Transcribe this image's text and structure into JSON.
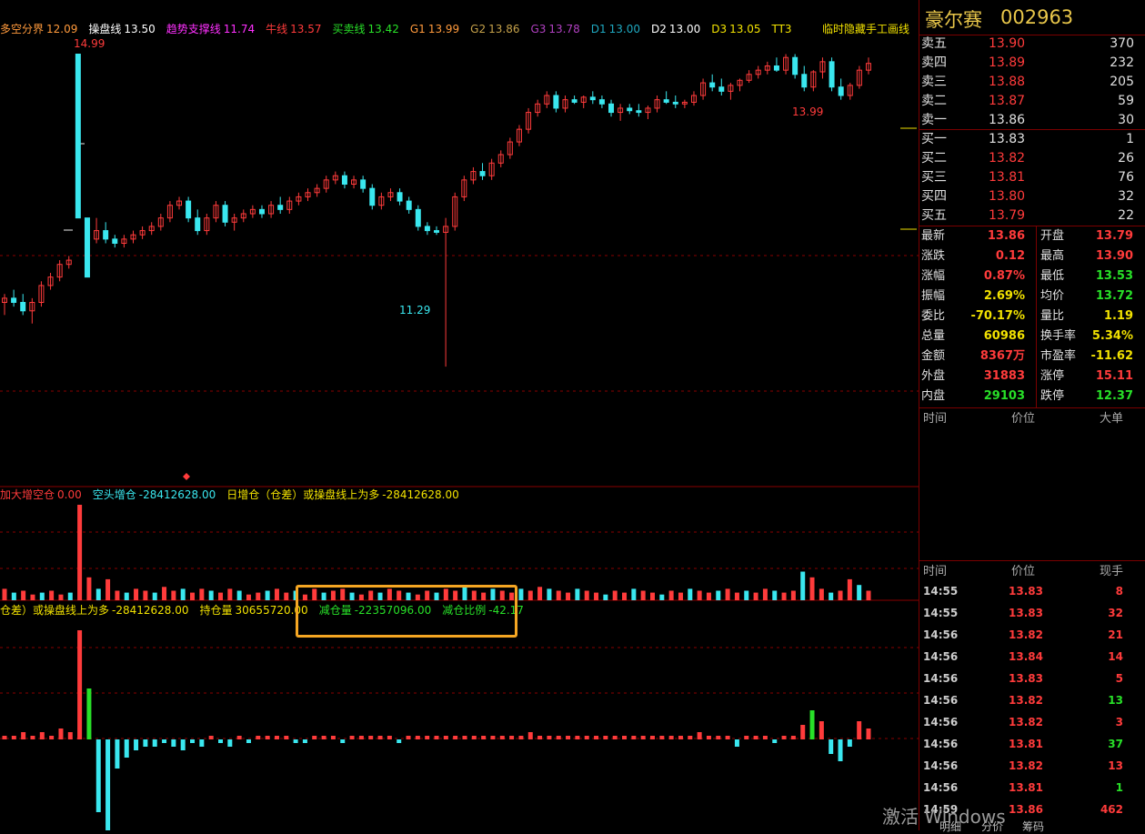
{
  "indicator_top": {
    "items": [
      {
        "label": "多空分界",
        "value": "12.09",
        "color": "#ff9a3c"
      },
      {
        "label": "操盘线",
        "value": "13.50",
        "color": "#ffffff"
      },
      {
        "label": "趋势支撑线",
        "value": "11.74",
        "color": "#ff30ff"
      },
      {
        "label": "牛线",
        "value": "13.57",
        "color": "#ff3b3b"
      },
      {
        "label": "买卖线",
        "value": "13.42",
        "color": "#28e028"
      },
      {
        "label": "G1",
        "value": "13.99",
        "color": "#ff9a3c"
      },
      {
        "label": "G2",
        "value": "13.86",
        "color": "#c5a14a"
      },
      {
        "label": "G3",
        "value": "13.78",
        "color": "#b040c0"
      },
      {
        "label": "D1",
        "value": "13.00",
        "color": "#1fa8c0"
      },
      {
        "label": "D2",
        "value": "13.00",
        "color": "#ffffff"
      },
      {
        "label": "D3",
        "value": "13.05",
        "color": "#f2e200"
      },
      {
        "label": "TT3",
        "value": "",
        "color": "#f2e200"
      }
    ],
    "right_label": "临时隐藏手工画线"
  },
  "indicator_mid": {
    "items": [
      {
        "label": "加大增空仓",
        "value": "0.00",
        "color": "#ff3b3b"
      },
      {
        "label": "空头增仓",
        "value": "-28412628.00",
        "color": "#3ae7ef"
      },
      {
        "label": "日增仓（仓差）或操盘线上为多",
        "value": "-28412628.00",
        "color": "#f2e200"
      }
    ]
  },
  "indicator_low": {
    "items": [
      {
        "label": "仓差）或操盘线上为多",
        "value": "-28412628.00",
        "color": "#f2e200"
      },
      {
        "label": "持仓量",
        "value": "30655720.00",
        "color": "#f2e200"
      },
      {
        "label": "减仓量",
        "value": "-22357096.00",
        "color": "#28e028"
      },
      {
        "label": "减仓比例",
        "value": "-42.17",
        "color": "#28e028"
      }
    ]
  },
  "price_labels": {
    "high": "14.99",
    "low": "11.29",
    "recent_high": "13.99"
  },
  "stock": {
    "name": "豪尔赛",
    "code": "002963"
  },
  "order_book": {
    "asks": [
      {
        "label": "卖五",
        "price": "13.90",
        "vol": "370",
        "color": "#ff3b3b"
      },
      {
        "label": "卖四",
        "price": "13.89",
        "vol": "232",
        "color": "#ff3b3b"
      },
      {
        "label": "卖三",
        "price": "13.88",
        "vol": "205",
        "color": "#ff3b3b"
      },
      {
        "label": "卖二",
        "price": "13.87",
        "vol": "59",
        "color": "#ff3b3b"
      },
      {
        "label": "卖一",
        "price": "13.86",
        "vol": "30",
        "color": "#e0e0e0"
      }
    ],
    "bids": [
      {
        "label": "买一",
        "price": "13.83",
        "vol": "1",
        "color": "#e0e0e0"
      },
      {
        "label": "买二",
        "price": "13.82",
        "vol": "26",
        "color": "#ff3b3b"
      },
      {
        "label": "买三",
        "price": "13.81",
        "vol": "76",
        "color": "#ff3b3b"
      },
      {
        "label": "买四",
        "price": "13.80",
        "vol": "32",
        "color": "#ff3b3b"
      },
      {
        "label": "买五",
        "price": "13.79",
        "vol": "22",
        "color": "#ff3b3b"
      }
    ]
  },
  "quote": [
    {
      "l1": "最新",
      "v1": "13.86",
      "c1": "#ff3b3b",
      "l2": "开盘",
      "v2": "13.79",
      "c2": "#ff3b3b"
    },
    {
      "l1": "涨跌",
      "v1": "0.12",
      "c1": "#ff3b3b",
      "l2": "最高",
      "v2": "13.90",
      "c2": "#ff3b3b"
    },
    {
      "l1": "涨幅",
      "v1": "0.87%",
      "c1": "#ff3b3b",
      "l2": "最低",
      "v2": "13.53",
      "c2": "#28e028"
    },
    {
      "l1": "振幅",
      "v1": "2.69%",
      "c1": "#f2e200",
      "l2": "均价",
      "v2": "13.72",
      "c2": "#28e028"
    },
    {
      "l1": "委比",
      "v1": "-70.17%",
      "c1": "#f2e200",
      "l2": "量比",
      "v2": "1.19",
      "c2": "#f2e200"
    },
    {
      "l1": "总量",
      "v1": "60986",
      "c1": "#f2e200",
      "l2": "换手率",
      "v2": "5.34%",
      "c2": "#f2e200"
    },
    {
      "l1": "金额",
      "v1": "8367万",
      "c1": "#ff3b3b",
      "l2": "市盈率",
      "v2": "-11.62",
      "c2": "#f2e200"
    },
    {
      "l1": "外盘",
      "v1": "31883",
      "c1": "#ff3b3b",
      "l2": "涨停",
      "v2": "15.11",
      "c2": "#ff3b3b"
    },
    {
      "l1": "内盘",
      "v1": "29103",
      "c1": "#28e028",
      "l2": "跌停",
      "v2": "12.37",
      "c2": "#28e028"
    }
  ],
  "big_order_header": {
    "time": "时间",
    "price": "价位",
    "big": "大单"
  },
  "tick_header": {
    "time": "时间",
    "price": "价位",
    "vol": "现手"
  },
  "ticks": [
    {
      "time": "14:55",
      "price": "13.83",
      "vol": "8",
      "color": "#ff3b3b"
    },
    {
      "time": "14:55",
      "price": "13.83",
      "vol": "32",
      "color": "#ff3b3b"
    },
    {
      "time": "14:56",
      "price": "13.82",
      "vol": "21",
      "color": "#ff3b3b"
    },
    {
      "time": "14:56",
      "price": "13.84",
      "vol": "14",
      "color": "#ff3b3b"
    },
    {
      "time": "14:56",
      "price": "13.83",
      "vol": "5",
      "color": "#ff3b3b"
    },
    {
      "time": "14:56",
      "price": "13.82",
      "vol": "13",
      "color": "#28e028"
    },
    {
      "time": "14:56",
      "price": "13.82",
      "vol": "3",
      "color": "#ff3b3b"
    },
    {
      "time": "14:56",
      "price": "13.81",
      "vol": "37",
      "color": "#28e028"
    },
    {
      "time": "14:56",
      "price": "13.82",
      "vol": "13",
      "color": "#ff3b3b"
    },
    {
      "time": "14:56",
      "price": "13.81",
      "vol": "1",
      "color": "#28e028"
    },
    {
      "time": "14:59",
      "price": "13.86",
      "vol": "462",
      "color": "#ff3b3b"
    }
  ],
  "bottom_tabs": [
    "明细",
    "分价",
    "筹码"
  ],
  "watermark": "激活 Windows",
  "candles": [
    [
      12.05,
      12.15,
      11.9,
      12.1
    ],
    [
      12.1,
      12.2,
      12.0,
      12.05
    ],
    [
      12.05,
      12.15,
      11.9,
      11.95
    ],
    [
      11.95,
      12.1,
      11.8,
      12.05
    ],
    [
      12.05,
      12.3,
      12.0,
      12.25
    ],
    [
      12.25,
      12.4,
      12.2,
      12.35
    ],
    [
      12.35,
      12.55,
      12.3,
      12.5
    ],
    [
      12.5,
      12.6,
      12.45,
      12.55
    ],
    [
      14.99,
      14.99,
      13.05,
      13.05
    ],
    [
      13.05,
      13.05,
      12.35,
      12.35
    ],
    [
      12.8,
      13.05,
      12.75,
      12.9
    ],
    [
      12.9,
      13.0,
      12.75,
      12.8
    ],
    [
      12.8,
      12.85,
      12.7,
      12.75
    ],
    [
      12.75,
      12.85,
      12.7,
      12.8
    ],
    [
      12.8,
      12.9,
      12.75,
      12.85
    ],
    [
      12.85,
      12.95,
      12.8,
      12.9
    ],
    [
      12.9,
      13.0,
      12.85,
      12.95
    ],
    [
      12.95,
      13.1,
      12.9,
      13.05
    ],
    [
      13.05,
      13.25,
      13.0,
      13.2
    ],
    [
      13.2,
      13.3,
      13.15,
      13.25
    ],
    [
      13.25,
      13.3,
      13.0,
      13.05
    ],
    [
      13.05,
      13.15,
      12.85,
      12.9
    ],
    [
      12.9,
      13.1,
      12.85,
      13.05
    ],
    [
      13.05,
      13.25,
      13.0,
      13.2
    ],
    [
      13.2,
      13.25,
      12.95,
      13.0
    ],
    [
      13.0,
      13.1,
      12.9,
      13.05
    ],
    [
      13.05,
      13.15,
      13.0,
      13.1
    ],
    [
      13.1,
      13.2,
      13.05,
      13.15
    ],
    [
      13.15,
      13.2,
      13.05,
      13.1
    ],
    [
      13.1,
      13.25,
      13.05,
      13.2
    ],
    [
      13.2,
      13.3,
      13.1,
      13.15
    ],
    [
      13.15,
      13.3,
      13.1,
      13.25
    ],
    [
      13.25,
      13.35,
      13.2,
      13.3
    ],
    [
      13.3,
      13.4,
      13.25,
      13.35
    ],
    [
      13.35,
      13.45,
      13.3,
      13.4
    ],
    [
      13.4,
      13.55,
      13.35,
      13.5
    ],
    [
      13.5,
      13.6,
      13.45,
      13.55
    ],
    [
      13.55,
      13.6,
      13.4,
      13.45
    ],
    [
      13.45,
      13.55,
      13.4,
      13.5
    ],
    [
      13.5,
      13.55,
      13.35,
      13.4
    ],
    [
      13.4,
      13.45,
      13.15,
      13.2
    ],
    [
      13.2,
      13.35,
      13.15,
      13.3
    ],
    [
      13.3,
      13.4,
      13.25,
      13.35
    ],
    [
      13.35,
      13.4,
      13.2,
      13.25
    ],
    [
      13.25,
      13.3,
      13.1,
      13.15
    ],
    [
      13.15,
      13.2,
      12.9,
      12.95
    ],
    [
      12.95,
      13.0,
      12.85,
      12.9
    ],
    [
      12.9,
      12.95,
      12.85,
      12.88
    ],
    [
      12.88,
      13.05,
      11.29,
      12.95
    ],
    [
      12.95,
      13.35,
      12.9,
      13.3
    ],
    [
      13.3,
      13.55,
      13.25,
      13.5
    ],
    [
      13.5,
      13.65,
      13.45,
      13.6
    ],
    [
      13.6,
      13.7,
      13.5,
      13.55
    ],
    [
      13.55,
      13.75,
      13.5,
      13.7
    ],
    [
      13.7,
      13.85,
      13.65,
      13.8
    ],
    [
      13.8,
      14.0,
      13.75,
      13.95
    ],
    [
      13.95,
      14.15,
      13.9,
      14.1
    ],
    [
      14.1,
      14.35,
      14.05,
      14.3
    ],
    [
      14.3,
      14.45,
      14.25,
      14.4
    ],
    [
      14.4,
      14.55,
      14.35,
      14.5
    ],
    [
      14.5,
      14.55,
      14.3,
      14.35
    ],
    [
      14.35,
      14.5,
      14.3,
      14.45
    ],
    [
      14.45,
      14.5,
      14.4,
      14.42
    ],
    [
      14.42,
      14.5,
      14.35,
      14.48
    ],
    [
      14.48,
      14.55,
      14.4,
      14.45
    ],
    [
      14.45,
      14.5,
      14.35,
      14.4
    ],
    [
      14.4,
      14.45,
      14.25,
      14.3
    ],
    [
      14.3,
      14.4,
      14.2,
      14.35
    ],
    [
      14.35,
      14.4,
      14.28,
      14.32
    ],
    [
      14.32,
      14.4,
      14.25,
      14.3
    ],
    [
      14.3,
      14.38,
      14.22,
      14.35
    ],
    [
      14.35,
      14.5,
      14.3,
      14.45
    ],
    [
      14.45,
      14.55,
      14.4,
      14.42
    ],
    [
      14.42,
      14.5,
      14.35,
      14.4
    ],
    [
      14.4,
      14.45,
      14.35,
      14.42
    ],
    [
      14.42,
      14.55,
      14.38,
      14.5
    ],
    [
      14.5,
      14.7,
      14.45,
      14.65
    ],
    [
      14.65,
      14.75,
      14.55,
      14.6
    ],
    [
      14.6,
      14.7,
      14.5,
      14.55
    ],
    [
      14.55,
      14.65,
      14.45,
      14.62
    ],
    [
      14.62,
      14.7,
      14.55,
      14.68
    ],
    [
      14.68,
      14.8,
      14.65,
      14.75
    ],
    [
      14.75,
      14.85,
      14.7,
      14.8
    ],
    [
      14.8,
      14.9,
      14.75,
      14.85
    ],
    [
      14.85,
      14.95,
      14.78,
      14.8
    ],
    [
      14.8,
      14.99,
      14.75,
      14.95
    ],
    [
      14.95,
      14.99,
      14.7,
      14.75
    ],
    [
      14.75,
      14.85,
      14.55,
      14.6
    ],
    [
      14.6,
      14.8,
      14.55,
      14.78
    ],
    [
      14.78,
      14.95,
      14.7,
      14.9
    ],
    [
      14.9,
      14.95,
      14.55,
      14.6
    ],
    [
      14.6,
      14.7,
      14.45,
      14.5
    ],
    [
      14.5,
      14.65,
      14.45,
      14.62
    ],
    [
      14.62,
      14.85,
      14.58,
      14.8
    ],
    [
      14.8,
      14.95,
      14.75,
      14.88
    ]
  ],
  "vol_bars": [
    0.6,
    0.4,
    0.5,
    0.3,
    0.4,
    0.5,
    0.3,
    0.4,
    5.0,
    1.2,
    0.6,
    1.1,
    0.5,
    0.4,
    0.6,
    0.5,
    0.4,
    0.7,
    0.5,
    0.6,
    0.4,
    0.6,
    0.5,
    0.4,
    0.6,
    0.5,
    0.3,
    0.4,
    0.5,
    0.6,
    0.4,
    0.5,
    0.3,
    0.6,
    0.4,
    0.5,
    0.6,
    0.4,
    0.3,
    0.5,
    0.4,
    0.6,
    0.5,
    0.4,
    0.3,
    0.5,
    0.4,
    0.6,
    0.5,
    0.7,
    0.5,
    0.4,
    0.6,
    0.5,
    0.4,
    0.6,
    0.5,
    0.7,
    0.6,
    0.5,
    0.4,
    0.6,
    0.5,
    0.4,
    0.3,
    0.5,
    0.4,
    0.6,
    0.5,
    0.4,
    0.3,
    0.5,
    0.4,
    0.6,
    0.5,
    0.4,
    0.5,
    0.6,
    0.4,
    0.5,
    0.4,
    0.6,
    0.5,
    0.4,
    0.5,
    1.5,
    1.2,
    0.6,
    0.4,
    0.5,
    1.1,
    0.8,
    0.5
  ],
  "pos_bars": [
    0.1,
    0.1,
    0.2,
    0.1,
    0.2,
    0.1,
    0.3,
    0.2,
    3.0,
    1.4,
    -2.0,
    -2.5,
    -0.8,
    -0.5,
    -0.3,
    -0.2,
    -0.2,
    -0.1,
    -0.2,
    -0.3,
    -0.1,
    -0.2,
    0.1,
    -0.1,
    -0.2,
    0.1,
    -0.1,
    0.1,
    0.1,
    0.1,
    0.1,
    -0.1,
    -0.1,
    0.1,
    0.1,
    0.1,
    -0.1,
    0.1,
    0.1,
    0.1,
    0.1,
    0.1,
    -0.1,
    0.1,
    0.1,
    0.1,
    0.1,
    0.1,
    0.1,
    0.1,
    0.1,
    0.1,
    0.1,
    0.1,
    0.1,
    0.1,
    0.2,
    0.1,
    0.1,
    0.1,
    0.1,
    0.1,
    0.1,
    0.1,
    0.1,
    0.1,
    0.1,
    0.1,
    0.1,
    0.1,
    0.1,
    0.1,
    0.1,
    0.1,
    0.2,
    0.1,
    0.1,
    0.1,
    -0.2,
    0.1,
    0.1,
    0.1,
    -0.1,
    0.1,
    0.1,
    0.4,
    0.8,
    0.5,
    -0.4,
    -0.6,
    -0.2,
    0.5,
    0.3
  ]
}
